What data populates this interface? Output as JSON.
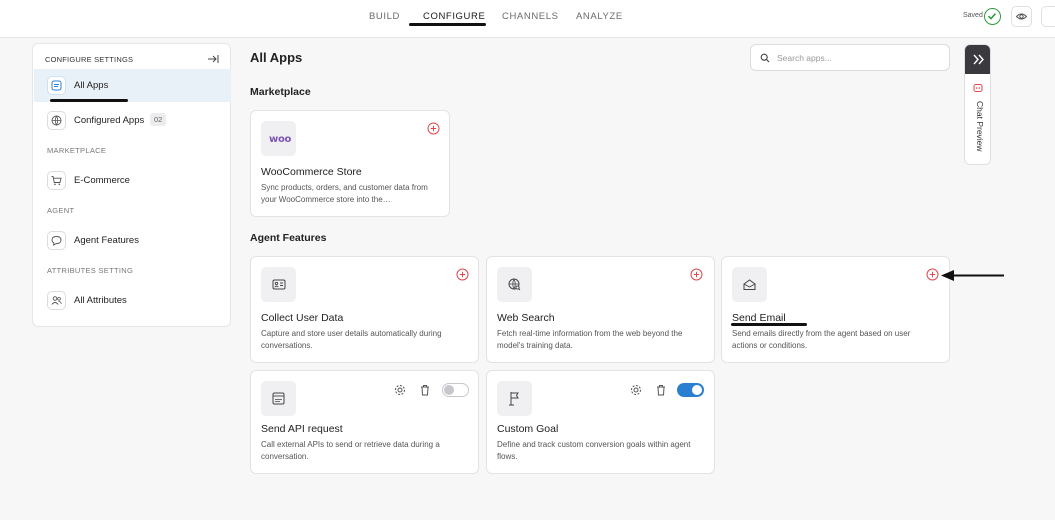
{
  "nav": {
    "tabs": [
      {
        "label": "BUILD"
      },
      {
        "label": "CONFIGURE",
        "active": true
      },
      {
        "label": "CHANNELS"
      },
      {
        "label": "ANALYZE"
      }
    ],
    "saved_label": "Saved"
  },
  "sidebar": {
    "header": "CONFIGURE SETTINGS",
    "items": [
      {
        "label": "All Apps",
        "icon": "apps-icon",
        "active": true
      },
      {
        "label": "Configured Apps",
        "badge": "02",
        "icon": "globe-icon"
      },
      {
        "label": "E-Commerce",
        "icon": "cart-icon"
      },
      {
        "label": "Agent Features",
        "icon": "chat-bubble-icon"
      },
      {
        "label": "All Attributes",
        "icon": "users-icon"
      }
    ],
    "sections": {
      "marketplace": "MARKETPLACE",
      "agent": "AGENT",
      "attributes": "ATTRIBUTES SETTING"
    }
  },
  "main": {
    "title": "All Apps",
    "search": {
      "placeholder": "Search apps..."
    },
    "marketplace": {
      "title": "Marketplace",
      "cards": [
        {
          "title": "WooCommerce Store",
          "desc": "Sync products, orders, and customer data from your WooCommerce store into the…",
          "logo_text": "woo"
        }
      ]
    },
    "agent_features": {
      "title": "Agent Features",
      "cards": [
        {
          "title": "Collect User Data",
          "desc": "Capture and store user details automatically during conversations.",
          "icon": "id-card-icon",
          "state": "add"
        },
        {
          "title": "Web Search",
          "desc": "Fetch real-time information from the web beyond the model's training data.",
          "icon": "globe-search-icon",
          "state": "add"
        },
        {
          "title": "Send Email",
          "desc": "Send emails directly from the agent based on user actions or conditions.",
          "icon": "mail-icon",
          "state": "add"
        },
        {
          "title": "Send API request",
          "desc": "Call external APIs to send or retrieve data during a conversation.",
          "icon": "api-icon",
          "state": "installed",
          "enabled": false
        },
        {
          "title": "Custom Goal",
          "desc": "Define and track custom conversion goals within agent flows.",
          "icon": "flag-icon",
          "state": "installed",
          "enabled": true
        }
      ]
    }
  },
  "chat_preview": {
    "label": "Chat Preview"
  },
  "colors": {
    "accent_red": "#e0474c",
    "toggle_on": "#2a7fd1",
    "saved_green": "#2e9a3e"
  }
}
